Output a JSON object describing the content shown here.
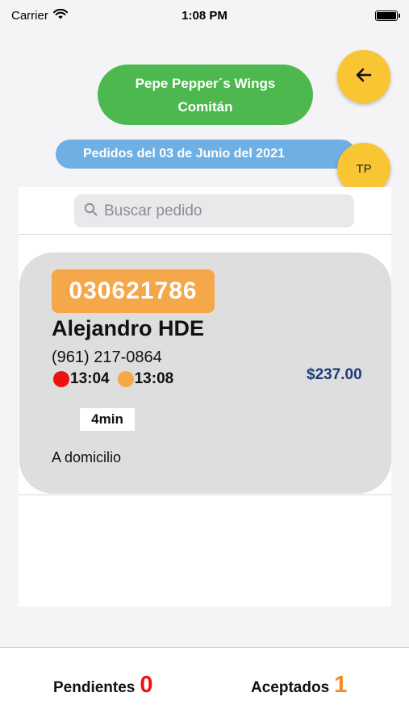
{
  "status_bar": {
    "carrier": "Carrier",
    "time": "1:08 PM"
  },
  "header": {
    "restaurant_line1": "Pepe Pepper´s Wings",
    "restaurant_line2": "Comitán",
    "date_label": "Pedidos del 03 de Junio del 2021",
    "tp_label": "TP",
    "back_icon": "arrow-left-icon"
  },
  "search": {
    "placeholder": "Buscar pedido",
    "value": ""
  },
  "orders": [
    {
      "id": "030621786",
      "customer": "Alejandro HDE",
      "phone": "(961) 217-0864",
      "time_received": "13:04",
      "time_accepted": "13:08",
      "total": "$237.00",
      "duration": "4min",
      "delivery_type": "A domicilio"
    }
  ],
  "tabs": {
    "pending_label": "Pendientes",
    "pending_count": "0",
    "accepted_label": "Aceptados",
    "accepted_count": "1"
  },
  "colors": {
    "restaurant_pill": "#4cb84e",
    "date_pill": "#6fb0e4",
    "fab": "#f9c532",
    "order_id_badge": "#f4a84a",
    "total_text": "#1f3a78",
    "pending_count": "#ee1111",
    "accepted_count": "#f08a24",
    "received_dot": "#ee1111",
    "accepted_dot": "#f4a84a"
  }
}
